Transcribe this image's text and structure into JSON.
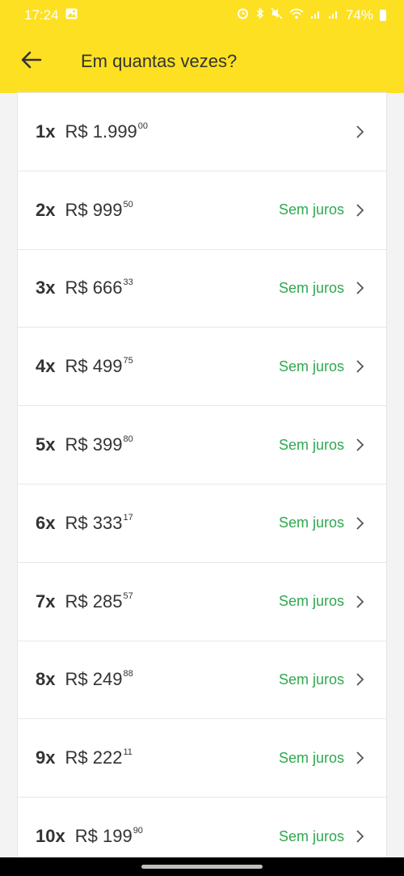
{
  "status_bar": {
    "time": "17:24",
    "battery": "74%",
    "icons": [
      "gallery-icon",
      "alarm-icon",
      "bluetooth-icon",
      "mute-icon",
      "wifi-icon",
      "signal-icon",
      "signal-icon",
      "battery-icon"
    ]
  },
  "header": {
    "title": "Em quantas vezes?",
    "back_icon": "arrow-left-icon",
    "background": "#fde022"
  },
  "installments": [
    {
      "qty": "1x",
      "currency": "R$",
      "amount": "1.999",
      "cents": "00",
      "badge": ""
    },
    {
      "qty": "2x",
      "currency": "R$",
      "amount": "999",
      "cents": "50",
      "badge": "Sem juros"
    },
    {
      "qty": "3x",
      "currency": "R$",
      "amount": "666",
      "cents": "33",
      "badge": "Sem juros"
    },
    {
      "qty": "4x",
      "currency": "R$",
      "amount": "499",
      "cents": "75",
      "badge": "Sem juros"
    },
    {
      "qty": "5x",
      "currency": "R$",
      "amount": "399",
      "cents": "80",
      "badge": "Sem juros"
    },
    {
      "qty": "6x",
      "currency": "R$",
      "amount": "333",
      "cents": "17",
      "badge": "Sem juros"
    },
    {
      "qty": "7x",
      "currency": "R$",
      "amount": "285",
      "cents": "57",
      "badge": "Sem juros"
    },
    {
      "qty": "8x",
      "currency": "R$",
      "amount": "249",
      "cents": "88",
      "badge": "Sem juros"
    },
    {
      "qty": "9x",
      "currency": "R$",
      "amount": "222",
      "cents": "11",
      "badge": "Sem juros"
    },
    {
      "qty": "10x",
      "currency": "R$",
      "amount": "199",
      "cents": "90",
      "badge": "Sem juros"
    }
  ],
  "colors": {
    "badge": "#2fa84f",
    "accent": "#fde022"
  }
}
